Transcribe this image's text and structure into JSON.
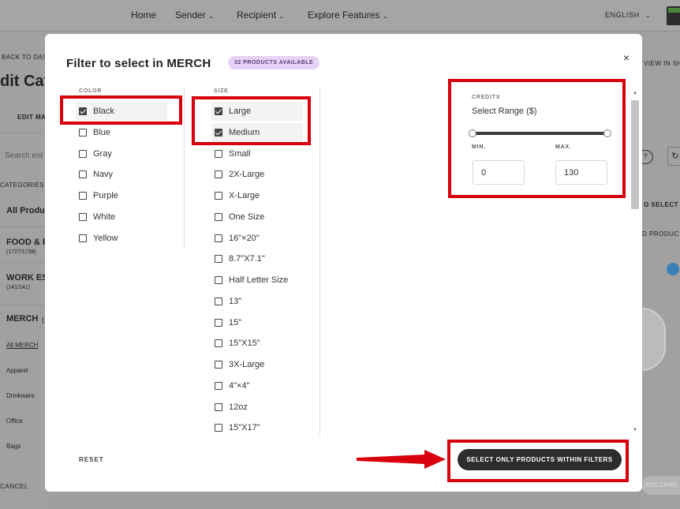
{
  "nav": {
    "items": [
      {
        "label": "Home"
      },
      {
        "label": "Sender",
        "has_chevron": true
      },
      {
        "label": "Recipient",
        "has_chevron": true
      },
      {
        "label": "Explore Features",
        "has_chevron": true
      }
    ],
    "language": "ENGLISH"
  },
  "background": {
    "back_link": "BACK TO DAS",
    "page_title": "dit Cat",
    "edit_label": "EDIT MA",
    "search_placeholder": "Search ent",
    "categories_label": "CATEGORIES",
    "all_products": "All Produ",
    "food": {
      "name": "FOOD & B",
      "count": "(1727/1738)"
    },
    "work": {
      "name": "WORK ES",
      "count": "(141/141)"
    },
    "merch": {
      "name": "MERCH",
      "suffix": "("
    },
    "merch_links": [
      "All MERCH",
      "Apparel",
      "Drinkware",
      "Office",
      "Bags"
    ],
    "cancel": "CANCEL",
    "view_in_shop": "VIEW IN SHO",
    "to_select": "O SELECT",
    "d_produc": "D PRODUC",
    "save_changes": "AVE CHAN"
  },
  "modal": {
    "title": "Filter to select in MERCH",
    "badge": "32 PRODUCTS AVAILABLE",
    "close_glyph": "×",
    "color": {
      "label": "COLOR",
      "options": [
        {
          "label": "Black",
          "checked": true
        },
        {
          "label": "Blue",
          "checked": false
        },
        {
          "label": "Gray",
          "checked": false
        },
        {
          "label": "Navy",
          "checked": false
        },
        {
          "label": "Purple",
          "checked": false
        },
        {
          "label": "White",
          "checked": false
        },
        {
          "label": "Yellow",
          "checked": false
        }
      ]
    },
    "size": {
      "label": "SIZE",
      "options": [
        {
          "label": "Large",
          "checked": true
        },
        {
          "label": "Medium",
          "checked": true
        },
        {
          "label": "Small",
          "checked": false
        },
        {
          "label": "2X-Large",
          "checked": false
        },
        {
          "label": "X-Large",
          "checked": false
        },
        {
          "label": "One Size",
          "checked": false
        },
        {
          "label": "16\"×20\"",
          "checked": false
        },
        {
          "label": "8.7\"X7.1\"",
          "checked": false
        },
        {
          "label": "Half Letter Size",
          "checked": false
        },
        {
          "label": "13\"",
          "checked": false
        },
        {
          "label": "15\"",
          "checked": false
        },
        {
          "label": "15\"X15\"",
          "checked": false
        },
        {
          "label": "3X-Large",
          "checked": false
        },
        {
          "label": "4\"×4\"",
          "checked": false
        },
        {
          "label": "12oz",
          "checked": false
        },
        {
          "label": "15\"X17\"",
          "checked": false
        }
      ]
    },
    "credits": {
      "label": "CREDITS",
      "range_title": "Select Range ($)",
      "min_label": "MIN.",
      "max_label": "MAX.",
      "min_value": "0",
      "max_value": "130"
    },
    "reset_label": "RESET",
    "apply_label": "SELECT ONLY PRODUCTS WITHIN FILTERS"
  },
  "colors": {
    "highlight": "#d8000c",
    "badge_bg": "#e6d2f6",
    "primary_button": "#2d2d2d"
  }
}
